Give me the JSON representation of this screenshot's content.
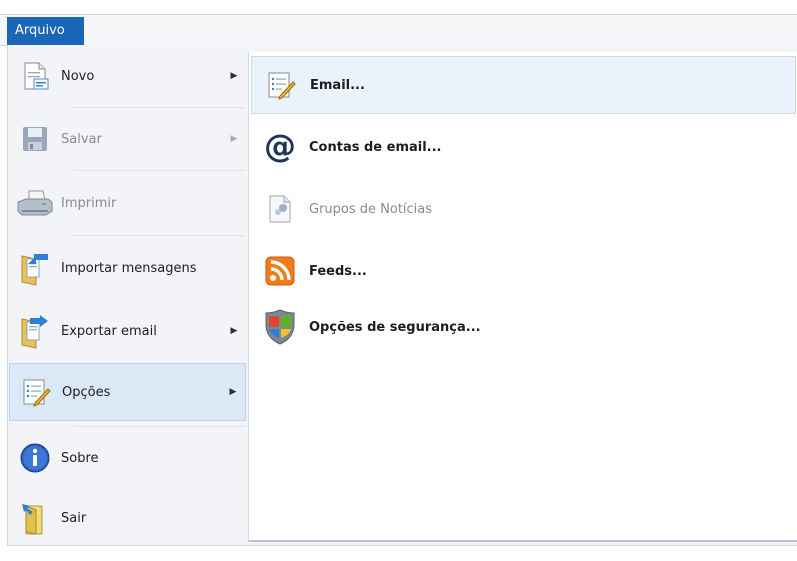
{
  "file_tab": {
    "label": "Arquivo"
  },
  "menu": {
    "items": [
      {
        "label": "Novo",
        "icon": "new-document-icon",
        "disabled": false,
        "has_submenu": true
      },
      {
        "label": "Salvar",
        "icon": "save-icon",
        "disabled": true,
        "has_submenu": true
      },
      {
        "label": "Imprimir",
        "icon": "printer-icon",
        "disabled": true,
        "has_submenu": false
      },
      {
        "label": "Importar mensagens",
        "icon": "import-folder-icon",
        "disabled": false,
        "has_submenu": false
      },
      {
        "label": "Exportar email",
        "icon": "export-folder-icon",
        "disabled": false,
        "has_submenu": true
      },
      {
        "label": "Opções",
        "icon": "options-notepad-icon",
        "disabled": false,
        "has_submenu": true,
        "selected": true
      },
      {
        "label": "Sobre",
        "icon": "info-icon",
        "disabled": false,
        "has_submenu": false
      },
      {
        "label": "Sair",
        "icon": "exit-icon",
        "disabled": false,
        "has_submenu": false
      }
    ],
    "arrow_glyph": "▶"
  },
  "submenu": {
    "items": [
      {
        "label": "Email...",
        "icon": "email-options-icon",
        "disabled": false
      },
      {
        "label": "Contas de email...",
        "icon": "at-sign-icon",
        "disabled": false
      },
      {
        "label": "Grupos de Notícias",
        "icon": "newsgroup-icon",
        "disabled": true
      },
      {
        "label": "Feeds...",
        "icon": "rss-feed-icon",
        "disabled": false
      },
      {
        "label": "Opções de segurança...",
        "icon": "security-shield-icon",
        "disabled": false
      }
    ]
  },
  "colors": {
    "accent": "#1a66b7",
    "selected_bg": "#dbe8f6",
    "hover_bg": "#eaf2fb",
    "rss_orange": "#f07d1a"
  }
}
